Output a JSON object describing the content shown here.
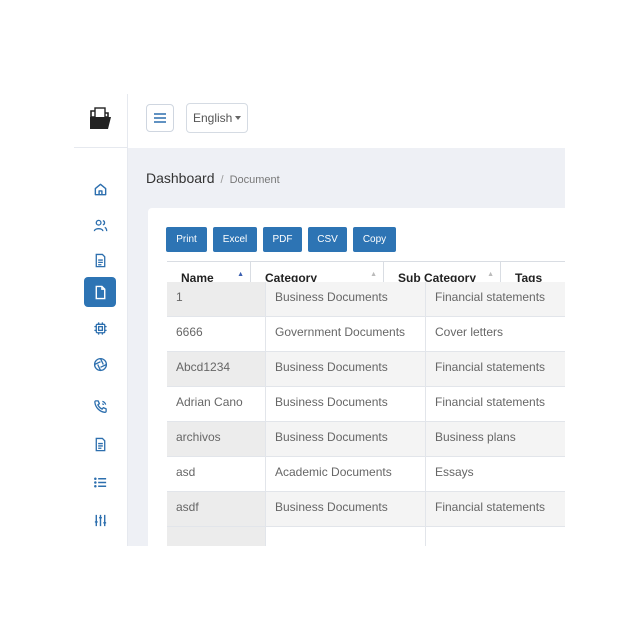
{
  "header": {
    "language": "English"
  },
  "breadcrumb": {
    "main": "Dashboard",
    "separator": "/",
    "current": "Document"
  },
  "sidebar": {
    "items": [
      {
        "icon": "home-icon"
      },
      {
        "icon": "users-icon"
      },
      {
        "icon": "document-icon"
      },
      {
        "icon": "file-icon",
        "active": true
      },
      {
        "icon": "chip-icon"
      },
      {
        "icon": "aperture-icon"
      },
      {
        "icon": "phone-icon"
      },
      {
        "icon": "document-lines-icon"
      },
      {
        "icon": "list-icon"
      },
      {
        "icon": "sliders-icon"
      }
    ],
    "active_color": "#2d74b4"
  },
  "toolbar": {
    "print": "Print",
    "excel": "Excel",
    "pdf": "PDF",
    "csv": "CSV",
    "copy": "Copy"
  },
  "table": {
    "columns": [
      "Name",
      "Category",
      "Sub Category",
      "Tags"
    ],
    "rows": [
      [
        "1",
        "Business Documents",
        "Financial statements"
      ],
      [
        "6666",
        "Government Documents",
        "Cover letters"
      ],
      [
        "Abcd1234",
        "Business Documents",
        "Financial statements"
      ],
      [
        "Adrian Cano",
        "Business Documents",
        "Financial statements"
      ],
      [
        "archivos",
        "Business Documents",
        "Business plans"
      ],
      [
        "asd",
        "Academic Documents",
        "Essays"
      ],
      [
        "asdf",
        "Business Documents",
        "Financial statements"
      ],
      [
        "",
        "",
        ""
      ]
    ]
  }
}
